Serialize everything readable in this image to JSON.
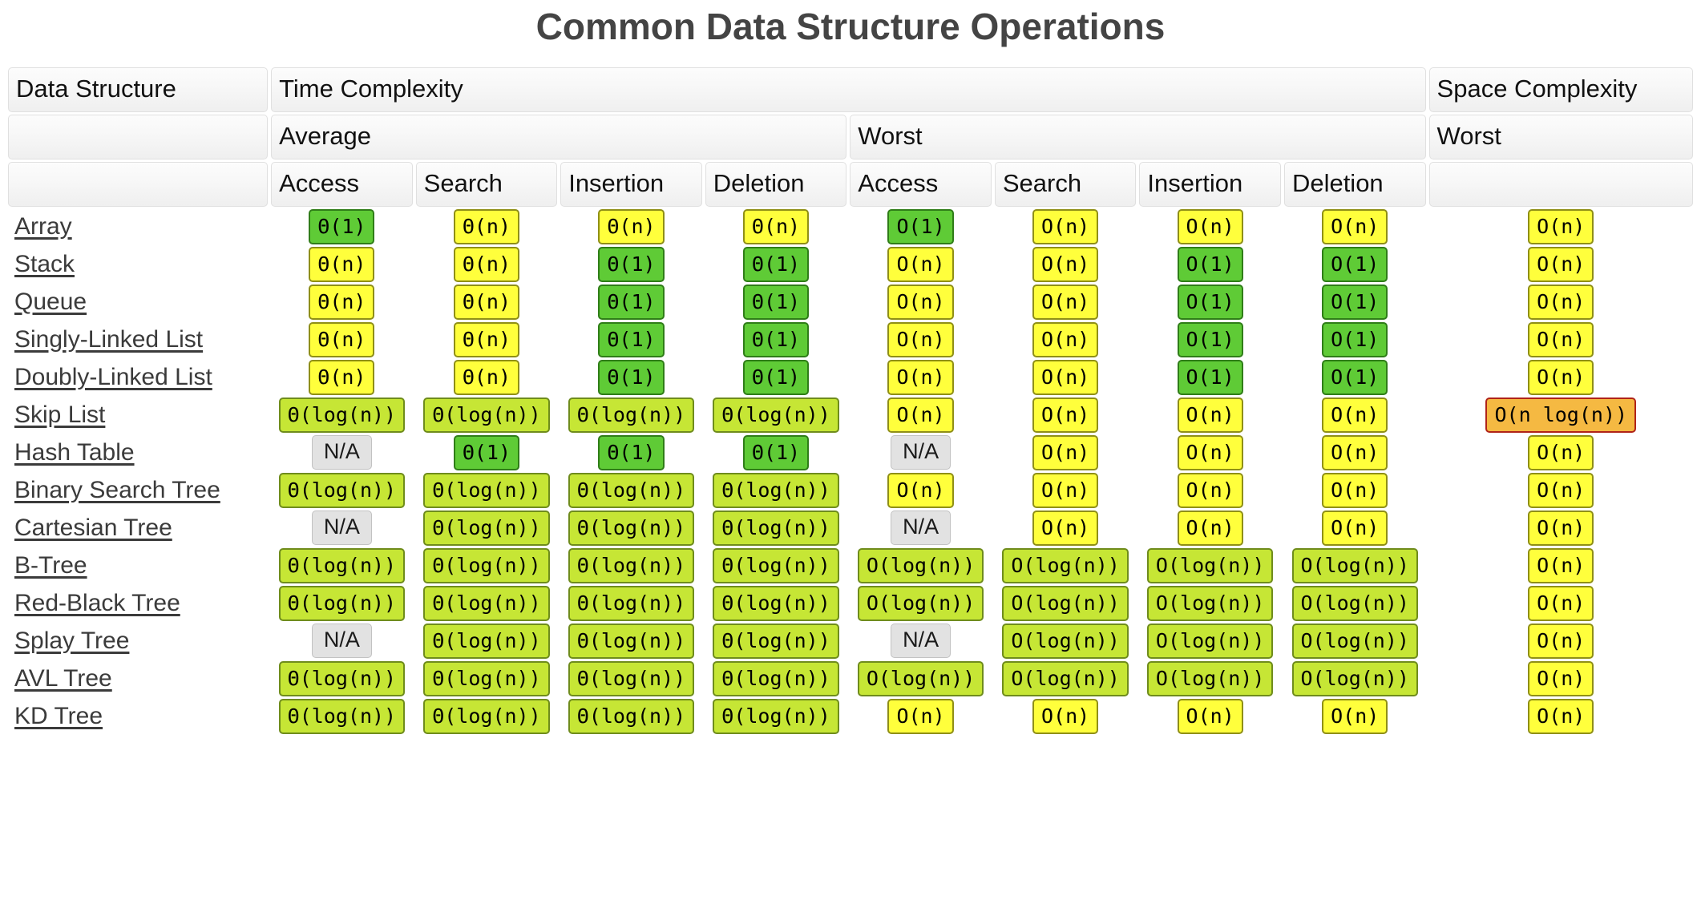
{
  "title": "Common Data Structure Operations",
  "colors": {
    "constant": "#5fcb36",
    "logarithmic": "#c6e635",
    "linear": "#ffff3c",
    "linearithmic": "#f5b942",
    "not_applicable": "#e2e2e2",
    "title": "#444444"
  },
  "header": {
    "row1": [
      {
        "label": "Data Structure",
        "span": 1
      },
      {
        "label": "Time Complexity",
        "span": 8
      },
      {
        "label": "Space Complexity",
        "span": 1
      }
    ],
    "row2": [
      {
        "label": "",
        "span": 1
      },
      {
        "label": "Average",
        "span": 4
      },
      {
        "label": "Worst",
        "span": 4
      },
      {
        "label": "Worst",
        "span": 1
      }
    ],
    "row3": [
      {
        "label": "",
        "span": 1
      },
      {
        "label": "Access",
        "span": 1
      },
      {
        "label": "Search",
        "span": 1
      },
      {
        "label": "Insertion",
        "span": 1
      },
      {
        "label": "Deletion",
        "span": 1
      },
      {
        "label": "Access",
        "span": 1
      },
      {
        "label": "Search",
        "span": 1
      },
      {
        "label": "Insertion",
        "span": 1
      },
      {
        "label": "Deletion",
        "span": 1
      },
      {
        "label": "",
        "span": 1
      }
    ]
  },
  "columns": [
    "Data Structure",
    "Average Access",
    "Average Search",
    "Average Insertion",
    "Average Deletion",
    "Worst Access",
    "Worst Search",
    "Worst Insertion",
    "Worst Deletion",
    "Space Worst"
  ],
  "rows": [
    {
      "name": "Array",
      "cells": [
        {
          "text": "Θ(1)",
          "kind": "green"
        },
        {
          "text": "Θ(n)",
          "kind": "yellow"
        },
        {
          "text": "Θ(n)",
          "kind": "yellow"
        },
        {
          "text": "Θ(n)",
          "kind": "yellow"
        },
        {
          "text": "O(1)",
          "kind": "green"
        },
        {
          "text": "O(n)",
          "kind": "yellow"
        },
        {
          "text": "O(n)",
          "kind": "yellow"
        },
        {
          "text": "O(n)",
          "kind": "yellow"
        },
        {
          "text": "O(n)",
          "kind": "yellow"
        }
      ]
    },
    {
      "name": "Stack",
      "cells": [
        {
          "text": "Θ(n)",
          "kind": "yellow"
        },
        {
          "text": "Θ(n)",
          "kind": "yellow"
        },
        {
          "text": "Θ(1)",
          "kind": "green"
        },
        {
          "text": "Θ(1)",
          "kind": "green"
        },
        {
          "text": "O(n)",
          "kind": "yellow"
        },
        {
          "text": "O(n)",
          "kind": "yellow"
        },
        {
          "text": "O(1)",
          "kind": "green"
        },
        {
          "text": "O(1)",
          "kind": "green"
        },
        {
          "text": "O(n)",
          "kind": "yellow"
        }
      ]
    },
    {
      "name": "Queue",
      "cells": [
        {
          "text": "Θ(n)",
          "kind": "yellow"
        },
        {
          "text": "Θ(n)",
          "kind": "yellow"
        },
        {
          "text": "Θ(1)",
          "kind": "green"
        },
        {
          "text": "Θ(1)",
          "kind": "green"
        },
        {
          "text": "O(n)",
          "kind": "yellow"
        },
        {
          "text": "O(n)",
          "kind": "yellow"
        },
        {
          "text": "O(1)",
          "kind": "green"
        },
        {
          "text": "O(1)",
          "kind": "green"
        },
        {
          "text": "O(n)",
          "kind": "yellow"
        }
      ]
    },
    {
      "name": "Singly-Linked List",
      "cells": [
        {
          "text": "Θ(n)",
          "kind": "yellow"
        },
        {
          "text": "Θ(n)",
          "kind": "yellow"
        },
        {
          "text": "Θ(1)",
          "kind": "green"
        },
        {
          "text": "Θ(1)",
          "kind": "green"
        },
        {
          "text": "O(n)",
          "kind": "yellow"
        },
        {
          "text": "O(n)",
          "kind": "yellow"
        },
        {
          "text": "O(1)",
          "kind": "green"
        },
        {
          "text": "O(1)",
          "kind": "green"
        },
        {
          "text": "O(n)",
          "kind": "yellow"
        }
      ]
    },
    {
      "name": "Doubly-Linked List",
      "cells": [
        {
          "text": "Θ(n)",
          "kind": "yellow"
        },
        {
          "text": "Θ(n)",
          "kind": "yellow"
        },
        {
          "text": "Θ(1)",
          "kind": "green"
        },
        {
          "text": "Θ(1)",
          "kind": "green"
        },
        {
          "text": "O(n)",
          "kind": "yellow"
        },
        {
          "text": "O(n)",
          "kind": "yellow"
        },
        {
          "text": "O(1)",
          "kind": "green"
        },
        {
          "text": "O(1)",
          "kind": "green"
        },
        {
          "text": "O(n)",
          "kind": "yellow"
        }
      ]
    },
    {
      "name": "Skip List",
      "cells": [
        {
          "text": "Θ(log(n))",
          "kind": "lime"
        },
        {
          "text": "Θ(log(n))",
          "kind": "lime"
        },
        {
          "text": "Θ(log(n))",
          "kind": "lime"
        },
        {
          "text": "Θ(log(n))",
          "kind": "lime"
        },
        {
          "text": "O(n)",
          "kind": "yellow"
        },
        {
          "text": "O(n)",
          "kind": "yellow"
        },
        {
          "text": "O(n)",
          "kind": "yellow"
        },
        {
          "text": "O(n)",
          "kind": "yellow"
        },
        {
          "text": "O(n log(n))",
          "kind": "orange"
        }
      ]
    },
    {
      "name": "Hash Table",
      "cells": [
        {
          "text": "N/A",
          "kind": "na"
        },
        {
          "text": "Θ(1)",
          "kind": "green"
        },
        {
          "text": "Θ(1)",
          "kind": "green"
        },
        {
          "text": "Θ(1)",
          "kind": "green"
        },
        {
          "text": "N/A",
          "kind": "na"
        },
        {
          "text": "O(n)",
          "kind": "yellow"
        },
        {
          "text": "O(n)",
          "kind": "yellow"
        },
        {
          "text": "O(n)",
          "kind": "yellow"
        },
        {
          "text": "O(n)",
          "kind": "yellow"
        }
      ]
    },
    {
      "name": "Binary Search Tree",
      "cells": [
        {
          "text": "Θ(log(n))",
          "kind": "lime"
        },
        {
          "text": "Θ(log(n))",
          "kind": "lime"
        },
        {
          "text": "Θ(log(n))",
          "kind": "lime"
        },
        {
          "text": "Θ(log(n))",
          "kind": "lime"
        },
        {
          "text": "O(n)",
          "kind": "yellow"
        },
        {
          "text": "O(n)",
          "kind": "yellow"
        },
        {
          "text": "O(n)",
          "kind": "yellow"
        },
        {
          "text": "O(n)",
          "kind": "yellow"
        },
        {
          "text": "O(n)",
          "kind": "yellow"
        }
      ]
    },
    {
      "name": "Cartesian Tree",
      "cells": [
        {
          "text": "N/A",
          "kind": "na"
        },
        {
          "text": "Θ(log(n))",
          "kind": "lime"
        },
        {
          "text": "Θ(log(n))",
          "kind": "lime"
        },
        {
          "text": "Θ(log(n))",
          "kind": "lime"
        },
        {
          "text": "N/A",
          "kind": "na"
        },
        {
          "text": "O(n)",
          "kind": "yellow"
        },
        {
          "text": "O(n)",
          "kind": "yellow"
        },
        {
          "text": "O(n)",
          "kind": "yellow"
        },
        {
          "text": "O(n)",
          "kind": "yellow"
        }
      ]
    },
    {
      "name": "B-Tree",
      "cells": [
        {
          "text": "Θ(log(n))",
          "kind": "lime"
        },
        {
          "text": "Θ(log(n))",
          "kind": "lime"
        },
        {
          "text": "Θ(log(n))",
          "kind": "lime"
        },
        {
          "text": "Θ(log(n))",
          "kind": "lime"
        },
        {
          "text": "O(log(n))",
          "kind": "lime"
        },
        {
          "text": "O(log(n))",
          "kind": "lime"
        },
        {
          "text": "O(log(n))",
          "kind": "lime"
        },
        {
          "text": "O(log(n))",
          "kind": "lime"
        },
        {
          "text": "O(n)",
          "kind": "yellow"
        }
      ]
    },
    {
      "name": "Red-Black Tree",
      "cells": [
        {
          "text": "Θ(log(n))",
          "kind": "lime"
        },
        {
          "text": "Θ(log(n))",
          "kind": "lime"
        },
        {
          "text": "Θ(log(n))",
          "kind": "lime"
        },
        {
          "text": "Θ(log(n))",
          "kind": "lime"
        },
        {
          "text": "O(log(n))",
          "kind": "lime"
        },
        {
          "text": "O(log(n))",
          "kind": "lime"
        },
        {
          "text": "O(log(n))",
          "kind": "lime"
        },
        {
          "text": "O(log(n))",
          "kind": "lime"
        },
        {
          "text": "O(n)",
          "kind": "yellow"
        }
      ]
    },
    {
      "name": "Splay Tree",
      "cells": [
        {
          "text": "N/A",
          "kind": "na"
        },
        {
          "text": "Θ(log(n))",
          "kind": "lime"
        },
        {
          "text": "Θ(log(n))",
          "kind": "lime"
        },
        {
          "text": "Θ(log(n))",
          "kind": "lime"
        },
        {
          "text": "N/A",
          "kind": "na"
        },
        {
          "text": "O(log(n))",
          "kind": "lime"
        },
        {
          "text": "O(log(n))",
          "kind": "lime"
        },
        {
          "text": "O(log(n))",
          "kind": "lime"
        },
        {
          "text": "O(n)",
          "kind": "yellow"
        }
      ]
    },
    {
      "name": "AVL Tree",
      "cells": [
        {
          "text": "Θ(log(n))",
          "kind": "lime"
        },
        {
          "text": "Θ(log(n))",
          "kind": "lime"
        },
        {
          "text": "Θ(log(n))",
          "kind": "lime"
        },
        {
          "text": "Θ(log(n))",
          "kind": "lime"
        },
        {
          "text": "O(log(n))",
          "kind": "lime"
        },
        {
          "text": "O(log(n))",
          "kind": "lime"
        },
        {
          "text": "O(log(n))",
          "kind": "lime"
        },
        {
          "text": "O(log(n))",
          "kind": "lime"
        },
        {
          "text": "O(n)",
          "kind": "yellow"
        }
      ]
    },
    {
      "name": "KD Tree",
      "cells": [
        {
          "text": "Θ(log(n))",
          "kind": "lime"
        },
        {
          "text": "Θ(log(n))",
          "kind": "lime"
        },
        {
          "text": "Θ(log(n))",
          "kind": "lime"
        },
        {
          "text": "Θ(log(n))",
          "kind": "lime"
        },
        {
          "text": "O(n)",
          "kind": "yellow"
        },
        {
          "text": "O(n)",
          "kind": "yellow"
        },
        {
          "text": "O(n)",
          "kind": "yellow"
        },
        {
          "text": "O(n)",
          "kind": "yellow"
        },
        {
          "text": "O(n)",
          "kind": "yellow"
        }
      ]
    }
  ]
}
